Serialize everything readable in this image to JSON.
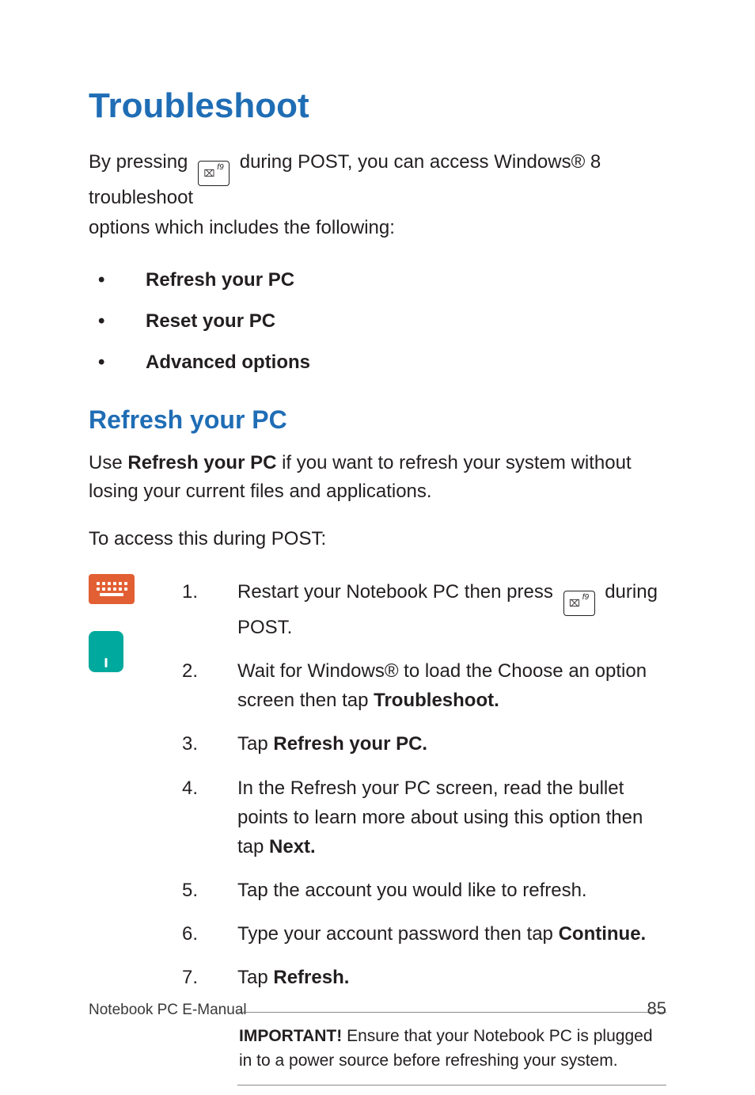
{
  "title": "Troubleshoot",
  "intro": {
    "pre": "By pressing ",
    "post_key": " during POST, you can access Windows® 8 troubleshoot",
    "line2": "options which includes the following:"
  },
  "key": {
    "glyph": "⌧",
    "fn": "f9"
  },
  "bullets": [
    "Refresh your PC",
    "Reset your PC",
    "Advanced options"
  ],
  "subhead": "Refresh your PC",
  "refresh_intro": {
    "pre": "Use ",
    "bold": "Refresh your PC",
    "post": " if you want to refresh your system without losing your current files and applications."
  },
  "access_line": "To access this during POST:",
  "icons": {
    "keyboard": "keyboard-icon",
    "touchpad": "touchpad-icon"
  },
  "steps": [
    {
      "pre": "Restart your Notebook PC then press ",
      "key": true,
      "post": " during POST."
    },
    {
      "pre": "Wait for Windows® to load the Choose an option screen then tap ",
      "bold": "Troubleshoot."
    },
    {
      "pre": "Tap ",
      "bold": "Refresh your PC."
    },
    {
      "pre": "In the Refresh your PC screen, read the bullet points to learn more about using this option then tap ",
      "bold": "Next."
    },
    {
      "pre": "Tap the account you would like to refresh."
    },
    {
      "pre": "Type your account password then tap ",
      "bold": "Continue."
    },
    {
      "pre": "Tap ",
      "bold": "Refresh."
    }
  ],
  "callout": {
    "label": "IMPORTANT!",
    "text": " Ensure that your Notebook PC is plugged in to a power source before refreshing your system."
  },
  "footer": {
    "left": "Notebook PC E-Manual",
    "right": "85"
  }
}
